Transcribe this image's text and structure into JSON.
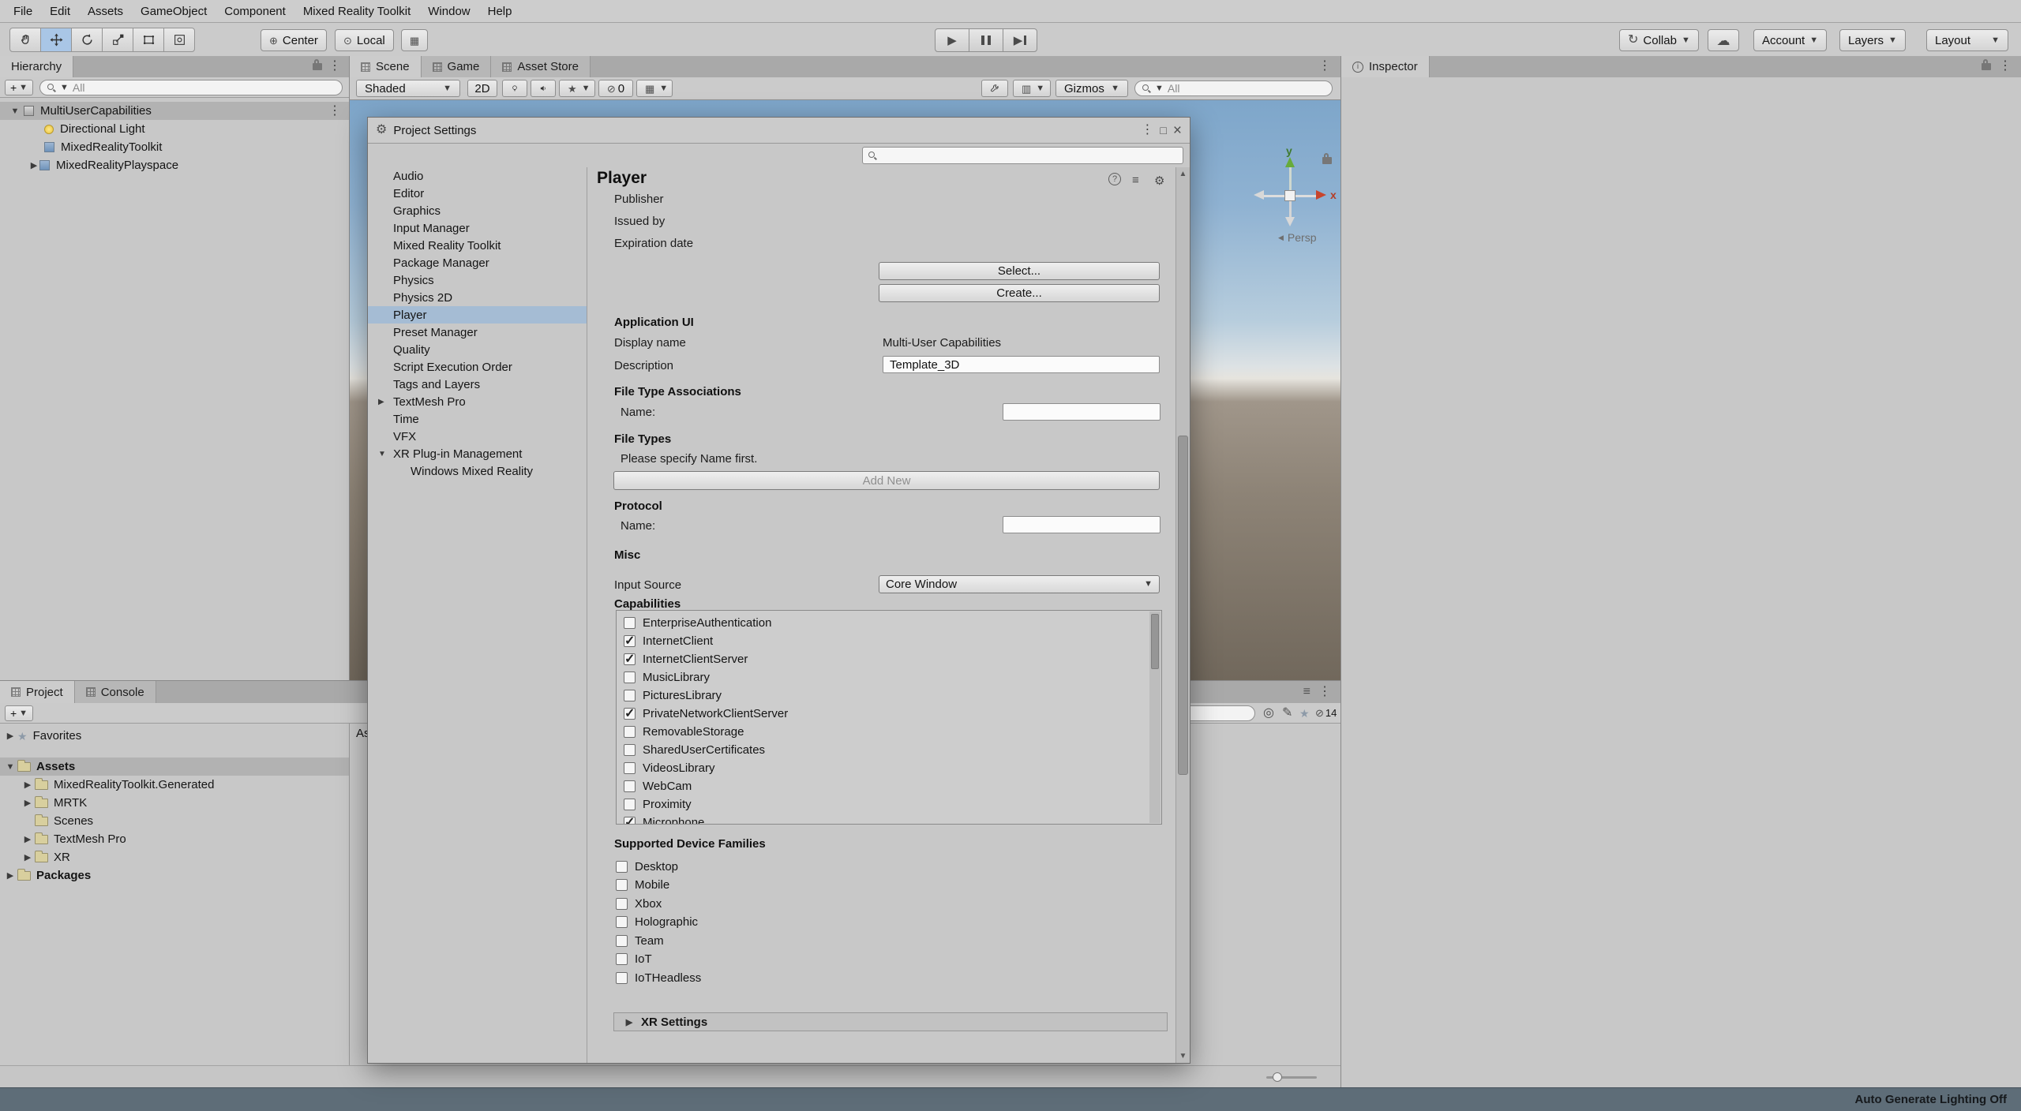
{
  "menu": {
    "items": [
      "File",
      "Edit",
      "Assets",
      "GameObject",
      "Component",
      "Mixed Reality Toolkit",
      "Window",
      "Help"
    ]
  },
  "toolbar": {
    "pivot_label": "Center",
    "space_label": "Local",
    "collab_label": "Collab",
    "account_label": "Account",
    "layers_label": "Layers",
    "layout_label": "Layout"
  },
  "hierarchy": {
    "tab": "Hierarchy",
    "search_value": "All",
    "root": {
      "label": "MultiUserCapabilities"
    },
    "children": [
      {
        "label": "Directional Light"
      },
      {
        "label": "MixedRealityToolkit"
      },
      {
        "label": "MixedRealityPlayspace"
      }
    ]
  },
  "scene": {
    "tabs": [
      {
        "label": "Scene"
      },
      {
        "label": "Game"
      },
      {
        "label": "Asset Store"
      }
    ],
    "shading": "Shaded",
    "toggle_2d": "2D",
    "eye_count": "0",
    "gizmos": "Gizmos",
    "search_value": "All",
    "camera_mode": "Persp",
    "axis_x": "x",
    "axis_y": "y"
  },
  "inspector": {
    "tab": "Inspector"
  },
  "project": {
    "tabs": [
      {
        "label": "Project"
      },
      {
        "label": "Console"
      }
    ],
    "hidden_count": "14",
    "breadcrumb": "Assets",
    "tree": [
      {
        "label": "Favorites"
      },
      {
        "label": "Assets"
      },
      {
        "label": "MixedRealityToolkit.Generated"
      },
      {
        "label": "MRTK"
      },
      {
        "label": "Scenes"
      },
      {
        "label": "TextMesh Pro"
      },
      {
        "label": "XR"
      },
      {
        "label": "Packages"
      }
    ]
  },
  "settings_window": {
    "title": "Project Settings",
    "nav": [
      {
        "label": "Audio"
      },
      {
        "label": "Editor"
      },
      {
        "label": "Graphics"
      },
      {
        "label": "Input Manager"
      },
      {
        "label": "Mixed Reality Toolkit"
      },
      {
        "label": "Package Manager"
      },
      {
        "label": "Physics"
      },
      {
        "label": "Physics 2D"
      },
      {
        "label": "Player"
      },
      {
        "label": "Preset Manager"
      },
      {
        "label": "Quality"
      },
      {
        "label": "Script Execution Order"
      },
      {
        "label": "Tags and Layers"
      },
      {
        "label": "TextMesh Pro"
      },
      {
        "label": "Time"
      },
      {
        "label": "VFX"
      },
      {
        "label": "XR Plug-in Management"
      },
      {
        "label": "Windows Mixed Reality"
      }
    ],
    "player": {
      "title": "Player",
      "publisher_label": "Publisher",
      "issued_by_label": "Issued by",
      "expiration_label": "Expiration date",
      "select_button": "Select...",
      "create_button": "Create...",
      "application_ui_header": "Application UI",
      "display_name_label": "Display name",
      "display_name_value": "Multi-User Capabilities",
      "description_label": "Description",
      "description_value": "Template_3D",
      "file_type_assoc_header": "File Type Associations",
      "name_label": "Name:",
      "file_types_header": "File Types",
      "file_types_hint": "Please specify Name first.",
      "add_new_button": "Add New",
      "protocol_header": "Protocol",
      "protocol_name_label": "Name:",
      "misc_header": "Misc",
      "input_source_label": "Input Source",
      "input_source_value": "Core Window",
      "capabilities_header": "Capabilities",
      "capabilities": [
        {
          "label": "EnterpriseAuthentication",
          "checked": false
        },
        {
          "label": "InternetClient",
          "checked": true
        },
        {
          "label": "InternetClientServer",
          "checked": true
        },
        {
          "label": "MusicLibrary",
          "checked": false
        },
        {
          "label": "PicturesLibrary",
          "checked": false
        },
        {
          "label": "PrivateNetworkClientServer",
          "checked": true
        },
        {
          "label": "RemovableStorage",
          "checked": false
        },
        {
          "label": "SharedUserCertificates",
          "checked": false
        },
        {
          "label": "VideosLibrary",
          "checked": false
        },
        {
          "label": "WebCam",
          "checked": false
        },
        {
          "label": "Proximity",
          "checked": false
        },
        {
          "label": "Microphone",
          "checked": true
        }
      ],
      "device_families_header": "Supported Device Families",
      "device_families": [
        {
          "label": "Desktop",
          "checked": false
        },
        {
          "label": "Mobile",
          "checked": false
        },
        {
          "label": "Xbox",
          "checked": false
        },
        {
          "label": "Holographic",
          "checked": false
        },
        {
          "label": "Team",
          "checked": false
        },
        {
          "label": "IoT",
          "checked": false
        },
        {
          "label": "IoTHeadless",
          "checked": false
        }
      ],
      "xr_settings_header": "XR Settings"
    }
  },
  "status_bar": {
    "right_text": "Auto Generate Lighting Off"
  }
}
